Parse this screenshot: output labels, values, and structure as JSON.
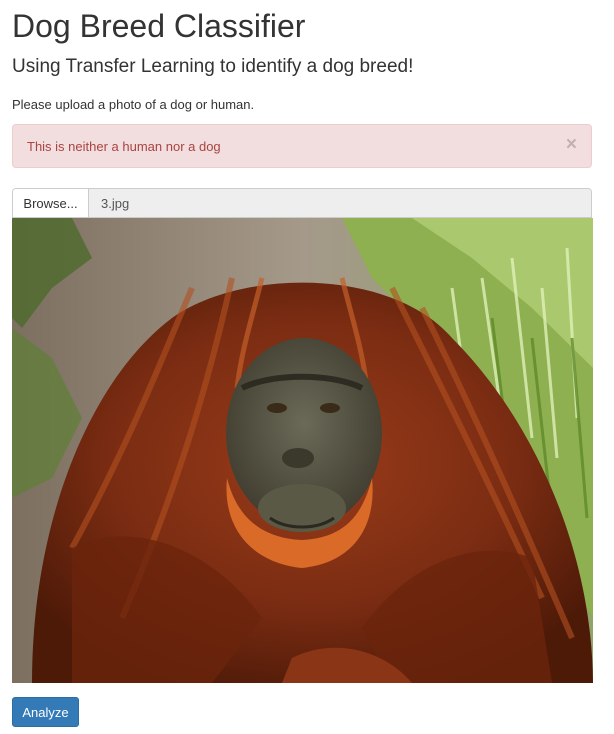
{
  "page": {
    "title": "Dog Breed Classifier",
    "subtitle": "Using Transfer Learning to identify a dog breed!",
    "instruction": "Please upload a photo of a dog or human."
  },
  "alert": {
    "message": "This is neither a human nor a dog",
    "close_symbol": "×",
    "color": "#a94442",
    "background": "#f2dede"
  },
  "file_input": {
    "browse_label": "Browse...",
    "filename": "3.jpg"
  },
  "preview": {
    "subject": "orangutan-photo"
  },
  "actions": {
    "analyze_label": "Analyze",
    "accent": "#337ab7"
  }
}
